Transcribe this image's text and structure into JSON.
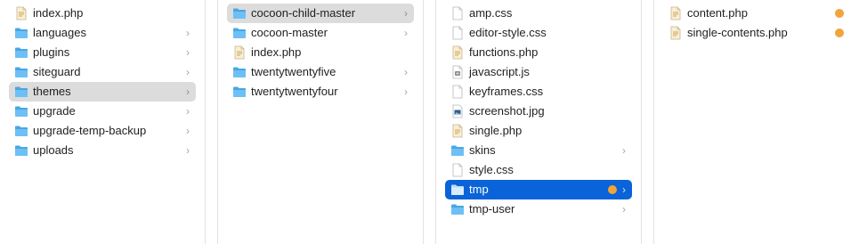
{
  "colors": {
    "folder": "#4aa8e6",
    "selection_active": "#0a63d8",
    "selection_inactive": "#dcdcdc",
    "orange_tag": "#f2a33a"
  },
  "columns": [
    {
      "items": [
        {
          "label": "index.php",
          "icon": "php-file-icon",
          "chevron": false
        },
        {
          "label": "languages",
          "icon": "folder-icon",
          "chevron": true
        },
        {
          "label": "plugins",
          "icon": "folder-icon",
          "chevron": true
        },
        {
          "label": "siteguard",
          "icon": "folder-icon",
          "chevron": true
        },
        {
          "label": "themes",
          "icon": "folder-icon",
          "chevron": true,
          "selected": "inactive"
        },
        {
          "label": "upgrade",
          "icon": "folder-icon",
          "chevron": true
        },
        {
          "label": "upgrade-temp-backup",
          "icon": "folder-icon",
          "chevron": true
        },
        {
          "label": "uploads",
          "icon": "folder-icon",
          "chevron": true
        }
      ]
    },
    {
      "items": [
        {
          "label": "cocoon-child-master",
          "icon": "folder-icon",
          "chevron": true,
          "selected": "inactive"
        },
        {
          "label": "cocoon-master",
          "icon": "folder-icon",
          "chevron": true
        },
        {
          "label": "index.php",
          "icon": "php-file-icon",
          "chevron": false
        },
        {
          "label": "twentytwentyfive",
          "icon": "folder-icon",
          "chevron": true
        },
        {
          "label": "twentytwentyfour",
          "icon": "folder-icon",
          "chevron": true
        }
      ]
    },
    {
      "items": [
        {
          "label": "amp.css",
          "icon": "document-icon",
          "chevron": false
        },
        {
          "label": "editor-style.css",
          "icon": "document-icon",
          "chevron": false
        },
        {
          "label": "functions.php",
          "icon": "php-file-icon",
          "chevron": false
        },
        {
          "label": "javascript.js",
          "icon": "script-file-icon",
          "chevron": false
        },
        {
          "label": "keyframes.css",
          "icon": "document-icon",
          "chevron": false
        },
        {
          "label": "screenshot.jpg",
          "icon": "image-file-icon",
          "chevron": false
        },
        {
          "label": "single.php",
          "icon": "php-file-icon",
          "chevron": false
        },
        {
          "label": "skins",
          "icon": "folder-icon",
          "chevron": true
        },
        {
          "label": "style.css",
          "icon": "document-icon",
          "chevron": false
        },
        {
          "label": "tmp",
          "icon": "folder-icon",
          "chevron": true,
          "selected": "active",
          "tag": "orange"
        },
        {
          "label": "tmp-user",
          "icon": "folder-icon",
          "chevron": true
        }
      ]
    },
    {
      "items": [
        {
          "label": "content.php",
          "icon": "php-file-icon",
          "chevron": false,
          "tag": "orange"
        },
        {
          "label": "single-contents.php",
          "icon": "php-file-icon",
          "chevron": false,
          "tag": "orange"
        }
      ]
    }
  ]
}
